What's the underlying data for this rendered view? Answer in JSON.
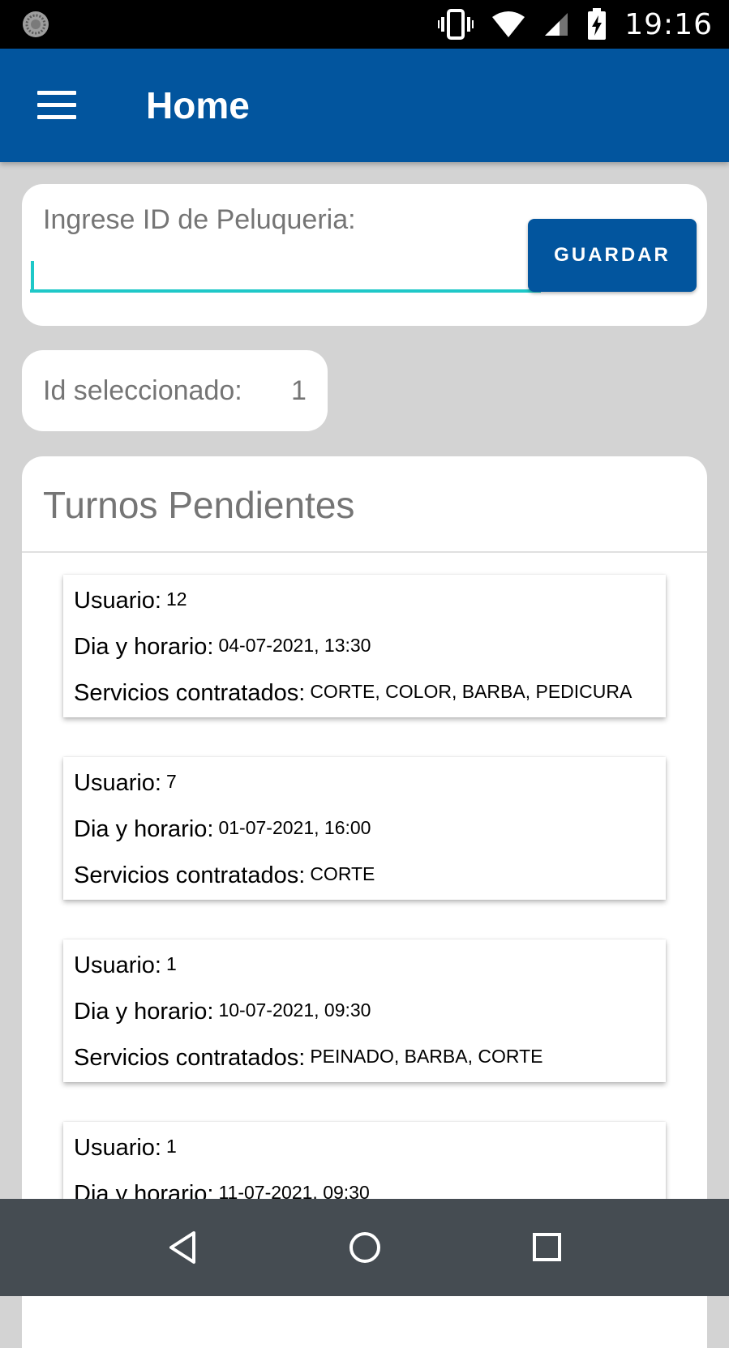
{
  "status_bar": {
    "time": "19:16",
    "icons": [
      "app-notification-icon",
      "vibrate-icon",
      "wifi-icon",
      "cell-signal-icon",
      "battery-charging-icon"
    ]
  },
  "app_bar": {
    "title": "Home",
    "menu_icon": "hamburger-menu-icon"
  },
  "input_card": {
    "label": "Ingrese ID de Peluqueria:",
    "value": "",
    "save_label": "GUARDAR"
  },
  "selected": {
    "label": "Id seleccionado:",
    "value": "1"
  },
  "turnos": {
    "title": "Turnos Pendientes",
    "user_label": "Usuario:",
    "datetime_label": "Dia y horario:",
    "services_label": "Servicios contratados:",
    "items": [
      {
        "usuario": "12",
        "horario": "04-07-2021, 13:30",
        "servicios": "CORTE, COLOR, BARBA, PEDICURA"
      },
      {
        "usuario": "7",
        "horario": "01-07-2021, 16:00",
        "servicios": "CORTE"
      },
      {
        "usuario": "1",
        "horario": "10-07-2021, 09:30",
        "servicios": "PEINADO, BARBA, CORTE"
      },
      {
        "usuario": "1",
        "horario": "11-07-2021, 09:30",
        "servicios": ""
      }
    ]
  },
  "nav_bar": {
    "icons": [
      "back-icon",
      "home-icon",
      "recents-icon"
    ]
  },
  "colors": {
    "primary": "#02559e",
    "accent": "#1ec8c8",
    "background": "#d3d3d3",
    "nav_bar": "#454c52"
  }
}
